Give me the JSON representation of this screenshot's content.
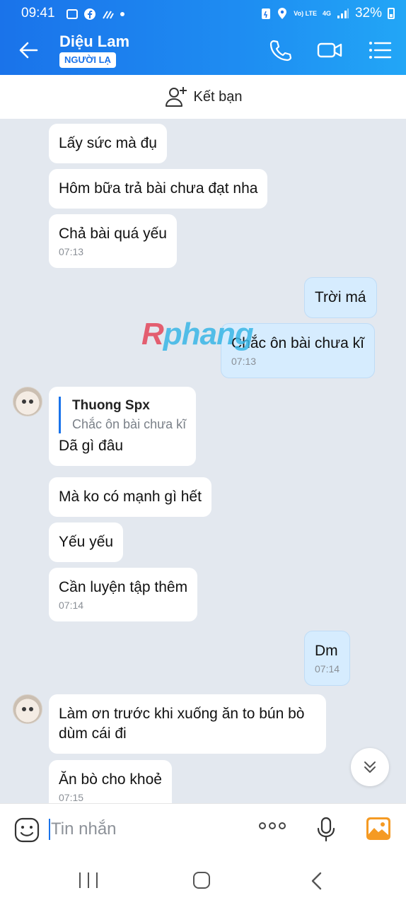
{
  "status_bar": {
    "time": "09:41",
    "network": "4G",
    "battery": "32%",
    "volte": "Vo) LTE"
  },
  "header": {
    "contact_name": "Diệu Lam",
    "badge": "NGƯỜI LẠ",
    "icons": [
      "back-arrow-icon",
      "phone-icon",
      "video-call-icon",
      "menu-icon"
    ]
  },
  "add_friend": {
    "label": "Kết bạn"
  },
  "messages": [
    {
      "dir": "in",
      "text": "Lấy sức mà đụ"
    },
    {
      "dir": "in",
      "text": "Hôm bữa trả bài chưa đạt nha"
    },
    {
      "dir": "in",
      "text": "Chả bài quá yếu",
      "time": "07:13"
    },
    {
      "dir": "out",
      "text": "Trời má"
    },
    {
      "dir": "out",
      "text": "Chắc ôn bài chưa kĩ",
      "time": "07:13"
    },
    {
      "dir": "in",
      "quote_name": "Thuong Spx",
      "quote_text": "Chắc ôn bài chưa kĩ",
      "text": "Dã gì đâu"
    },
    {
      "dir": "in",
      "text": "Mà ko có mạnh gì hết"
    },
    {
      "dir": "in",
      "text": "Yếu yếu"
    },
    {
      "dir": "in",
      "text": "Cần luyện tập thêm",
      "time": "07:14"
    },
    {
      "dir": "out",
      "text": "Dm",
      "time": "07:14"
    },
    {
      "dir": "in",
      "text": "Làm ơn trước khi xuống ăn to bún bò dùm cái đi"
    },
    {
      "dir": "in",
      "text": "Ăn bò cho khoẻ",
      "time": "07:15"
    }
  ],
  "watermark": {
    "first": "R",
    "rest": "phang"
  },
  "composer": {
    "placeholder": "Tin nhắn"
  },
  "colors": {
    "header_blue": "#1a73ea",
    "outgoing_bubble": "#d6ecfe",
    "chat_background": "#e3e8ef"
  }
}
